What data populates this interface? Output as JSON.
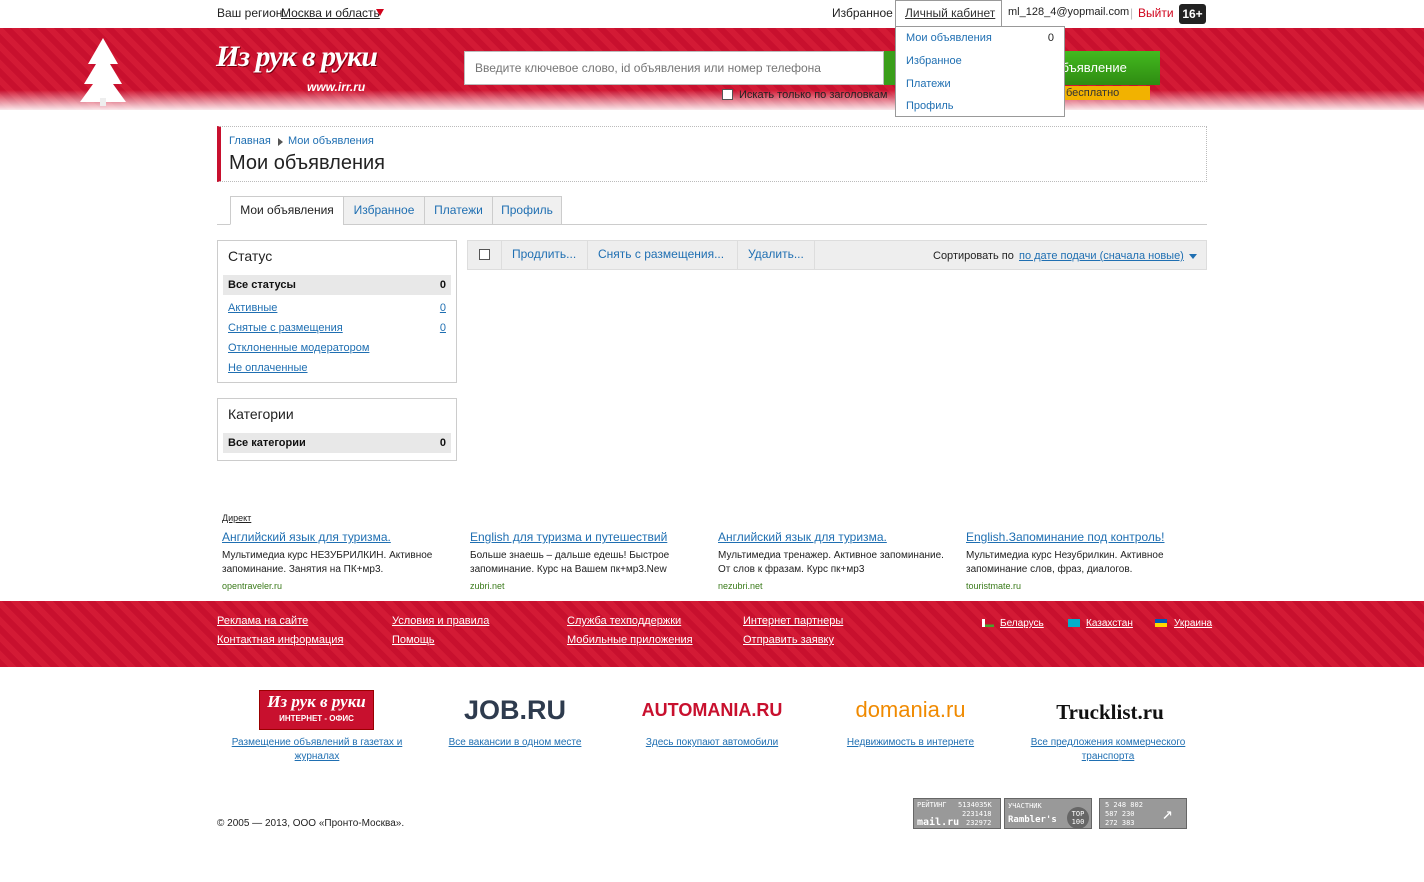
{
  "topbar": {
    "region_label": "Ваш регион:",
    "region_value": "Москва и область",
    "favorites": "Избранное",
    "cabinet": "Личный кабинет",
    "email": "ml_128_4@yopmail.com",
    "separator": "|",
    "logout": "Выйти",
    "age": "16+"
  },
  "header": {
    "logo": "Из рук в руки",
    "logo_url": "www.irr.ru",
    "search_placeholder": "Введите ключевое слово, id объявления или номер телефона",
    "post_button": "ть объявление",
    "post_free": "бесплатно",
    "title_only_label": "Искать только по заголовкам"
  },
  "dropdown": {
    "items": [
      "Мои объявления",
      "Избранное",
      "Платежи",
      "Профиль"
    ],
    "count": "0"
  },
  "breadcrumb": {
    "home": "Главная",
    "current": "Мои объявления"
  },
  "page_title": "Мои объявления",
  "tabs": [
    "Мои объявления",
    "Избранное",
    "Платежи",
    "Профиль"
  ],
  "status_box": {
    "title": "Статус",
    "all_label": "Все статусы",
    "all_count": "0",
    "items": [
      {
        "label": "Активные",
        "count": "0"
      },
      {
        "label": "Снятые с размещения",
        "count": "0"
      },
      {
        "label": "Отклоненные модератором",
        "count": ""
      },
      {
        "label": "Не оплаченные",
        "count": ""
      }
    ]
  },
  "category_box": {
    "title": "Категории",
    "all_label": "Все категории",
    "all_count": "0"
  },
  "actions": {
    "extend": "Продлить...",
    "remove": "Снять с размещения...",
    "delete": "Удалить...",
    "sort_label": "Сортировать по",
    "sort_value": "по дате подачи (сначала новые)"
  },
  "ads": {
    "direct": "Директ",
    "items": [
      {
        "title": "Английский язык для туризма.",
        "text": "Мультимедиа курс НЕЗУБРИЛКИН. Активное запоминание. Занятия на ПК+мр3.",
        "domain": "opentraveler.ru"
      },
      {
        "title": "English для туризма и путешествий",
        "text": "Больше знаешь – дальше едешь! Быстрое запоминание. Курс на Вашем пк+мр3.New",
        "domain": "zubri.net"
      },
      {
        "title": "Английский язык для туризма.",
        "text": "Мультимедиа тренажер. Активное запоминание. От слов к фразам. Курс пк+мр3",
        "domain": "nezubri.net"
      },
      {
        "title": "English.Запоминание под контроль!",
        "text": "Мультимедиа курс Незубрилкин. Активное запоминание слов, фраз, диалогов.",
        "domain": "touristmate.ru"
      }
    ]
  },
  "footer": {
    "links": [
      "Реклама на сайте",
      "Контактная информация",
      "Условия и правила",
      "Помощь",
      "Служба техподдержки",
      "Мобильные приложения",
      "Интернет партнеры",
      "Отправить заявку"
    ],
    "countries": [
      "Беларусь",
      "Казахстан",
      "Украина"
    ]
  },
  "partners": [
    {
      "logo": "Из рук в руки",
      "logo_sub": "ИНТЕРНЕТ - ОФИС",
      "link": "Размещение объявлений в газетах и журналах"
    },
    {
      "logo": "JOB.RU",
      "link": "Все вакансии в одном месте"
    },
    {
      "logo": "AUTOMANIA.RU",
      "link": "Здесь покупают автомобили"
    },
    {
      "logo": "domania.ru",
      "link": "Недвижимость в интернете"
    },
    {
      "logo": "Trucklist.ru",
      "link": "Все предложения коммерческого транспорта"
    }
  ],
  "copyright": "© 2005 — 2013, ООО «Пронто-Москва».",
  "counters": {
    "mail": {
      "label": "РЕЙТИНГ",
      "brand": "mail.ru",
      "values": [
        "5134035К",
        "2231418",
        "232972"
      ]
    },
    "rambler": {
      "label": "УЧАСТНИК",
      "brand": "Rambler's",
      "top": "TOP 100"
    },
    "li": {
      "values": [
        "5 248 802",
        "587 230",
        "272 383"
      ]
    }
  },
  "colors": {
    "brand_red": "#c8102e",
    "link_blue": "#1f6fb2",
    "green": "#3a9e1a"
  }
}
